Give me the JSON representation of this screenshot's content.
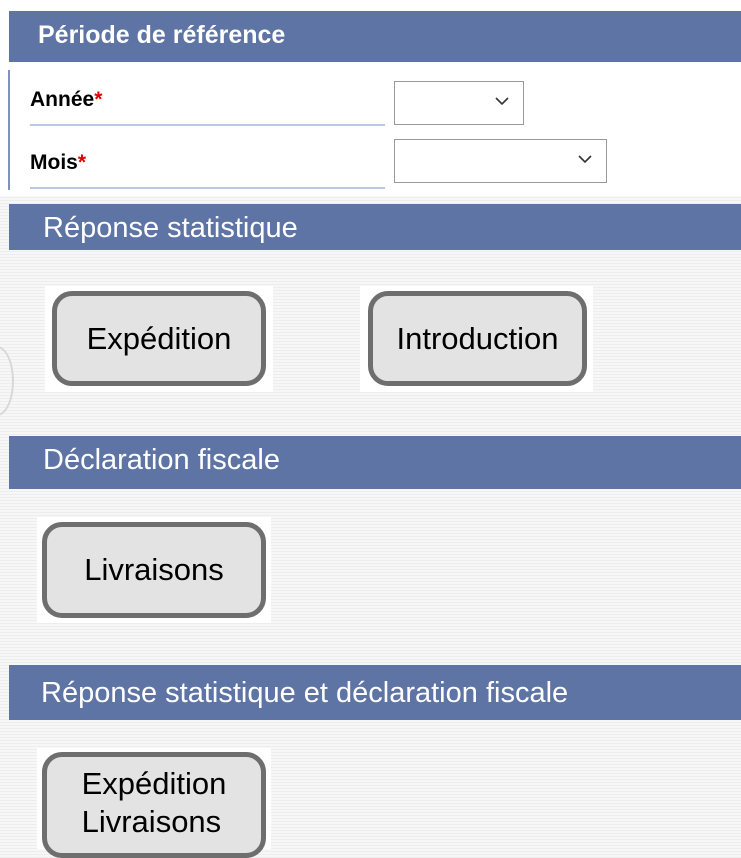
{
  "periode": {
    "title": "Période de référence",
    "annee_label": "Année",
    "mois_label": "Mois",
    "required_marker": "*",
    "annee_value": "",
    "mois_value": ""
  },
  "reponse_statistique": {
    "title": "Réponse statistique",
    "expedition_label": "Expédition",
    "introduction_label": "Introduction"
  },
  "declaration_fiscale": {
    "title": "Déclaration fiscale",
    "livraisons_label": "Livraisons"
  },
  "combined": {
    "title": "Réponse statistique et  déclaration fiscale",
    "button_line1": "Expédition",
    "button_line2": "Livraisons"
  },
  "colors": {
    "header_bar": "#5e74a4",
    "button_fill": "#e3e3e3",
    "button_border": "#6e6e6e",
    "required": "#e00000"
  },
  "icons": {
    "select_arrow": "chevron-down-icon"
  }
}
